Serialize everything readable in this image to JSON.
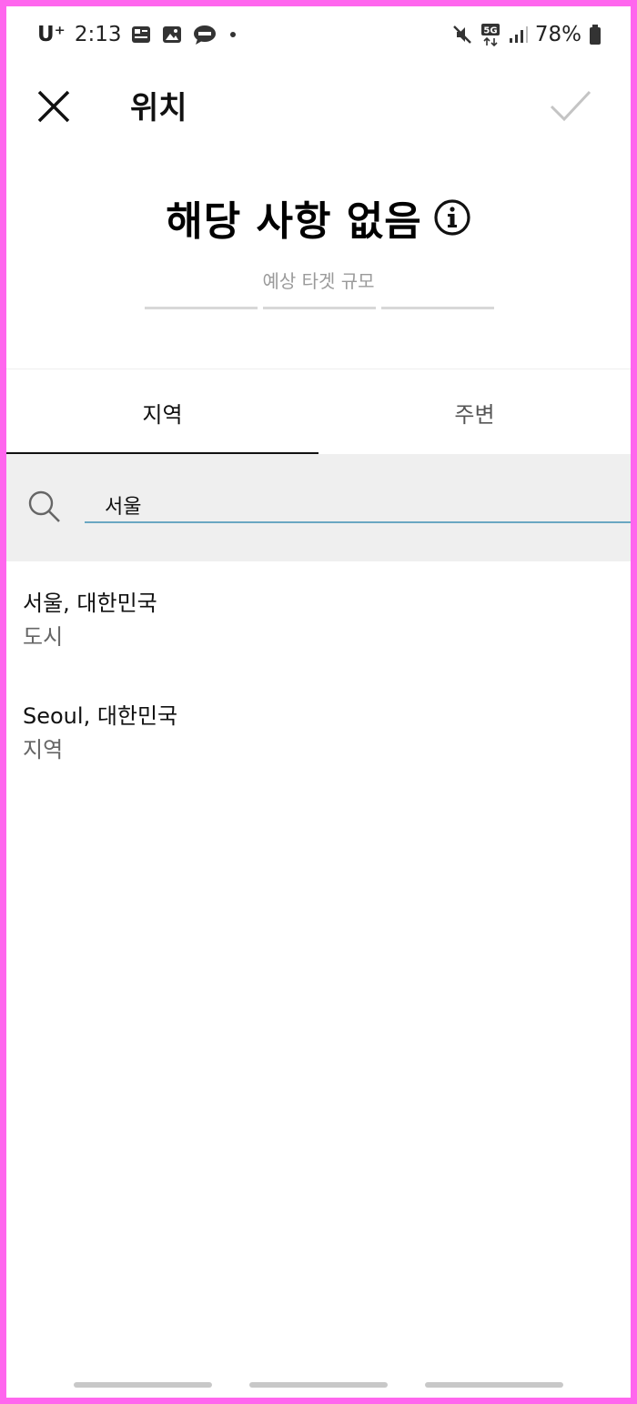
{
  "status_bar": {
    "carrier": "U⁺",
    "time": "2:13",
    "battery": "78%",
    "network": "5G",
    "left_icons": [
      "newspaper-icon",
      "gallery-icon",
      "talk-icon"
    ],
    "right_icons": [
      "mute-icon",
      "5g-icon",
      "signal-icon",
      "battery-icon"
    ]
  },
  "app_bar": {
    "title": "위치",
    "close_icon": "close-icon",
    "confirm_icon": "check-icon"
  },
  "audience": {
    "title": "해당 사항 없음",
    "subtitle": "예상 타겟 규모",
    "meter_segments": 3
  },
  "tabs": [
    {
      "label": "지역",
      "active": true
    },
    {
      "label": "주변",
      "active": false
    }
  ],
  "search": {
    "value": "서울",
    "icon": "search-icon"
  },
  "results": [
    {
      "name": "서울, 대한민국",
      "type": "도시"
    },
    {
      "name": "Seoul, 대한민국",
      "type": "지역"
    }
  ],
  "colors": {
    "frame_border": "#ff66ee",
    "search_underline": "#6aa7c2",
    "search_bg": "#efefef"
  }
}
